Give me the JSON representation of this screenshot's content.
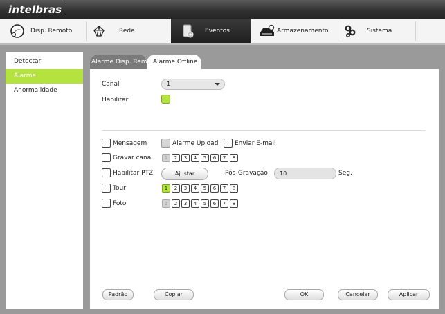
{
  "app": {
    "brand": "intelbras"
  },
  "nav": [
    {
      "label": "Disp. Remoto",
      "icon": "remote-device-icon"
    },
    {
      "label": "Rede",
      "icon": "network-icon"
    },
    {
      "label": "Eventos",
      "icon": "events-icon"
    },
    {
      "label": "Armazenamento",
      "icon": "storage-icon"
    },
    {
      "label": "Sistema",
      "icon": "system-gears-icon"
    }
  ],
  "nav_active": "Eventos",
  "sidebar": {
    "items": [
      "Detectar",
      "Alarme",
      "Anormalidade"
    ],
    "active": "Alarme"
  },
  "tabs": [
    {
      "label": "Alarme Disp. Remoto"
    },
    {
      "label": "Alarme Offline"
    }
  ],
  "tab_active": "Alarme Offline",
  "form": {
    "canal_label": "Canal",
    "canal_value": "1",
    "habilitar_label": "Habilitar",
    "habilitar_checked": true,
    "mensagem_label": "Mensagem",
    "alarme_upload_label": "Alarme Upload",
    "enviar_email_label": "Enviar E-mail",
    "gravar_canal_label": "Gravar canal",
    "habilitar_ptz_label": "Habilitar PTZ",
    "ajustar_label": "Ajustar",
    "pos_gravacao_label": "Pós-Gravação",
    "pos_gravacao_value": "10",
    "seg_label": "Seg.",
    "tour_label": "Tour",
    "foto_label": "Foto",
    "channels": [
      "1",
      "2",
      "3",
      "4",
      "5",
      "6",
      "7",
      "8"
    ],
    "gravar_channel_1_disabled": true,
    "tour_selected_channel": "1",
    "foto_channel_1_disabled": true
  },
  "buttons": {
    "padrao": "Padrão",
    "copiar": "Copiar",
    "ok": "OK",
    "cancelar": "Cancelar",
    "aplicar": "Aplicar"
  },
  "colors": {
    "accent": "#b4e23e",
    "titlebar": "#2f2f2f",
    "nav_active": "#262626",
    "inactive_tab": "#7a7a7a",
    "background": "#9a9a9a"
  }
}
